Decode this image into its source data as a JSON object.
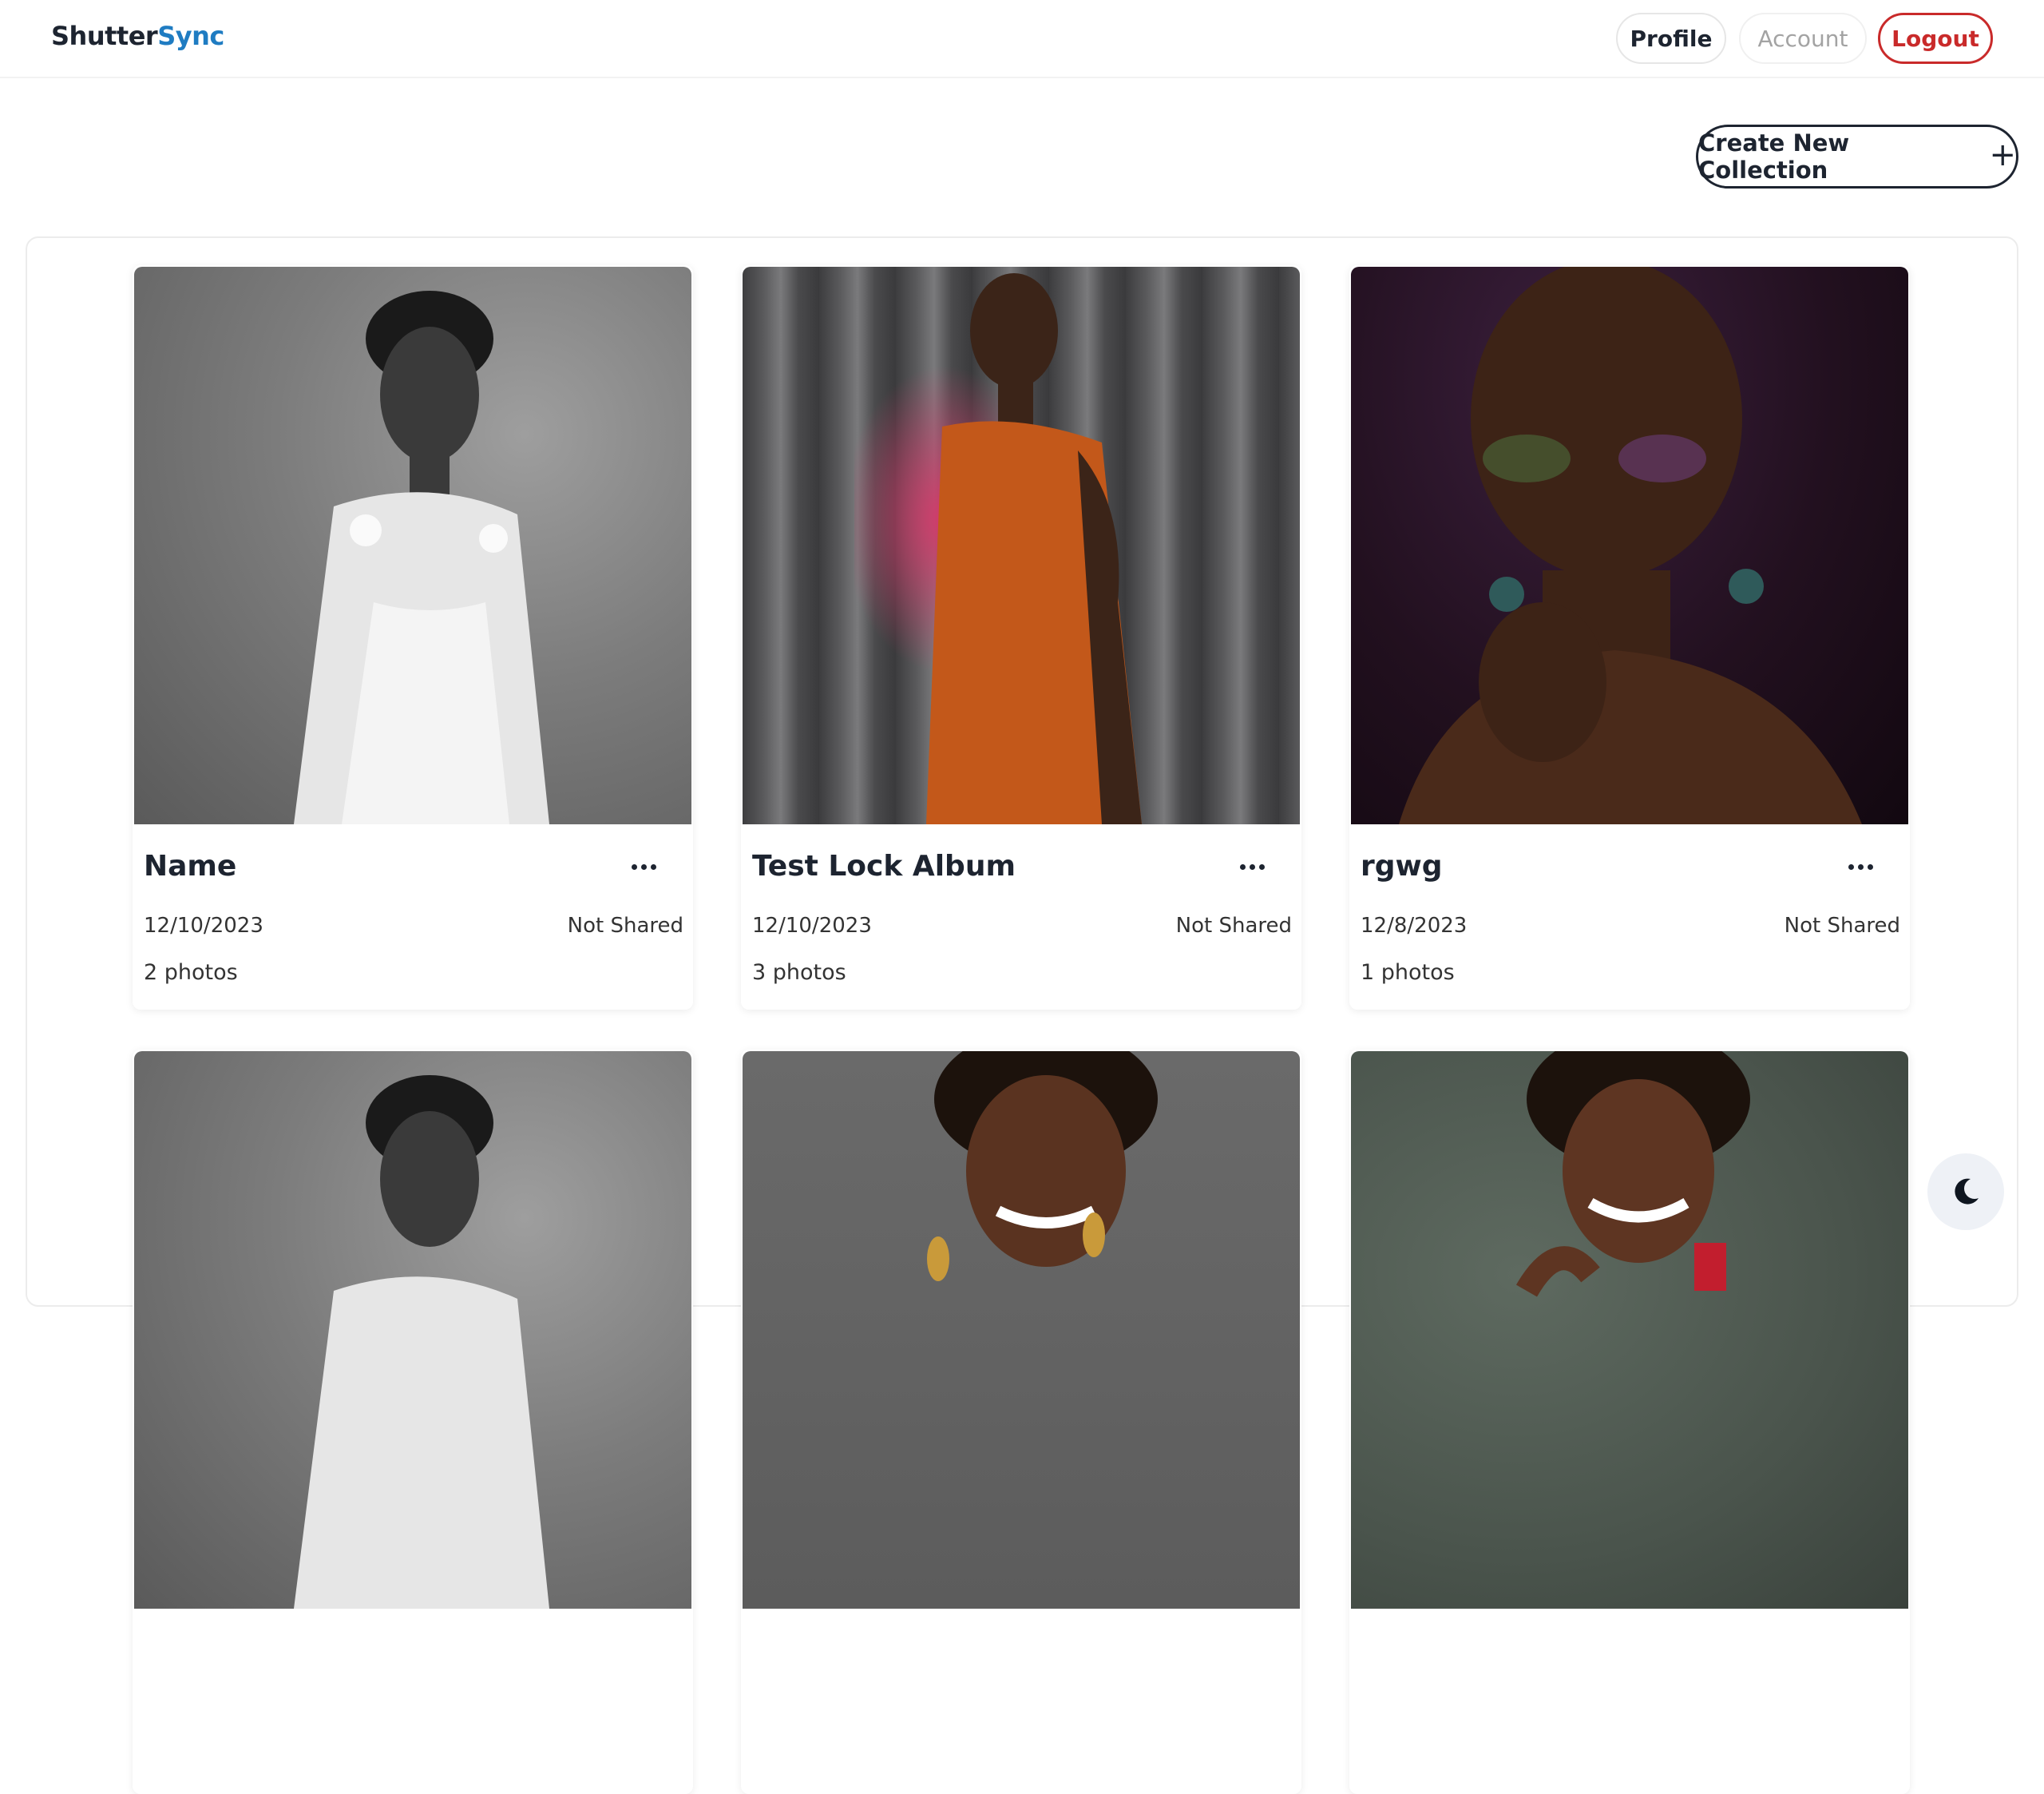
{
  "brand": {
    "part1": "Shutter",
    "part2": "Sync",
    "accent": "#1f7cc2"
  },
  "nav": {
    "profile": "Profile",
    "account": "Account",
    "logout": "Logout",
    "logout_color": "#c92a2a"
  },
  "actions": {
    "create_label": "Create New Collection",
    "create_icon": "plus-icon"
  },
  "collections": [
    {
      "title": "Name",
      "date": "12/10/2023",
      "share_status": "Not Shared",
      "photo_count": "2 photos"
    },
    {
      "title": "Test Lock Album",
      "date": "12/10/2023",
      "share_status": "Not Shared",
      "photo_count": "3 photos"
    },
    {
      "title": "rgwg",
      "date": "12/8/2023",
      "share_status": "Not Shared",
      "photo_count": "1 photos"
    },
    {
      "title": "",
      "date": "",
      "share_status": "",
      "photo_count": ""
    },
    {
      "title": "",
      "date": "",
      "share_status": "",
      "photo_count": ""
    },
    {
      "title": "",
      "date": "",
      "share_status": "",
      "photo_count": ""
    }
  ],
  "theme_toggle": {
    "icon": "moon-icon"
  }
}
